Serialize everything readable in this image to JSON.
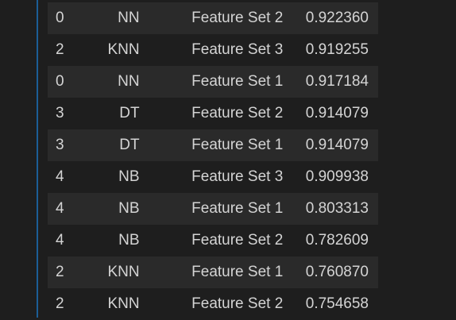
{
  "table": {
    "rows": [
      {
        "index": "0",
        "model": "NN",
        "feature_set": "Feature Set 2",
        "score": "0.922360"
      },
      {
        "index": "2",
        "model": "KNN",
        "feature_set": "Feature Set 3",
        "score": "0.919255"
      },
      {
        "index": "0",
        "model": "NN",
        "feature_set": "Feature Set 1",
        "score": "0.917184"
      },
      {
        "index": "3",
        "model": "DT",
        "feature_set": "Feature Set 2",
        "score": "0.914079"
      },
      {
        "index": "3",
        "model": "DT",
        "feature_set": "Feature Set 1",
        "score": "0.914079"
      },
      {
        "index": "4",
        "model": "NB",
        "feature_set": "Feature Set 3",
        "score": "0.909938"
      },
      {
        "index": "4",
        "model": "NB",
        "feature_set": "Feature Set 1",
        "score": "0.803313"
      },
      {
        "index": "4",
        "model": "NB",
        "feature_set": "Feature Set 2",
        "score": "0.782609"
      },
      {
        "index": "2",
        "model": "KNN",
        "feature_set": "Feature Set 1",
        "score": "0.760870"
      },
      {
        "index": "2",
        "model": "KNN",
        "feature_set": "Feature Set 2",
        "score": "0.754658"
      }
    ]
  },
  "colors": {
    "background": "#1e1e1e",
    "row_alt": "#2a2a2a",
    "text": "#d4d4d4",
    "gutter_accent": "#1b5e96"
  }
}
